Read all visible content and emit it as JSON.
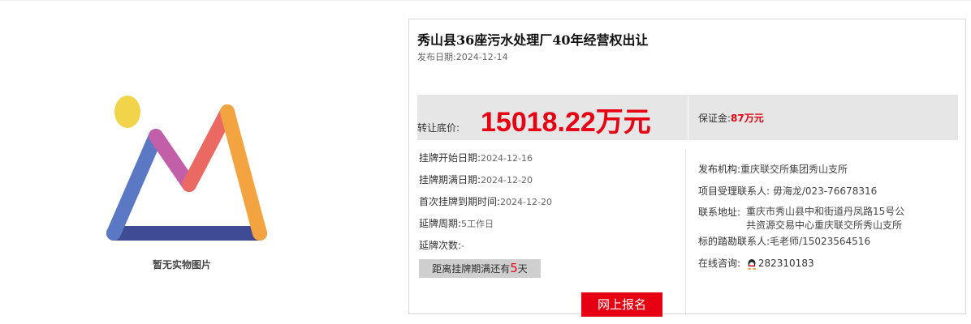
{
  "image_placeholder": {
    "caption": "暂无实物图片"
  },
  "listing": {
    "title": "秀山县36座污水处理厂40年经营权出让",
    "publish_date_label": "发布日期:",
    "publish_date": "2024-12-14"
  },
  "price": {
    "label": "转让底价:",
    "value": "15018.22万元",
    "deposit_label": "保证金:",
    "deposit_value": "87万元"
  },
  "schedule": {
    "start_label": "挂牌开始日期:",
    "start_value": "2024-12-16",
    "end_label": "挂牌期满日期:",
    "end_value": "2024-12-20",
    "first_expiry_label": "首次挂牌到期时间:",
    "first_expiry_value": "2024-12-20",
    "extension_period_label": "延牌周期:",
    "extension_period_value": "5工作日",
    "extension_count_label": "延牌次数:",
    "extension_count_value": "-"
  },
  "countdown": {
    "prefix": "距离挂牌期满还有",
    "days": "5",
    "suffix": "天"
  },
  "contact": {
    "publisher_label": "发布机构:",
    "publisher_value": "重庆联交所集团秀山支所",
    "project_contact_label": "项目受理联系人:",
    "project_contact_value": "毋海龙/023-76678316",
    "address_label": "联系地址:",
    "address_value": "重庆市秀山县中和街道丹凤路15号公共资源交易中心重庆联交所秀山支所",
    "inspection_label": "标的踏勘联系人:",
    "inspection_value": "毛老师/15023564516",
    "online_label": "在线咨询:",
    "qq_number": "282310183"
  },
  "actions": {
    "apply_label": "网上报名"
  },
  "icons": {
    "qq": "qq-penguin-icon",
    "placeholder": "image-placeholder-icon"
  },
  "colors": {
    "accent_red": "#e60012",
    "band_gray": "#e6e6e6"
  }
}
